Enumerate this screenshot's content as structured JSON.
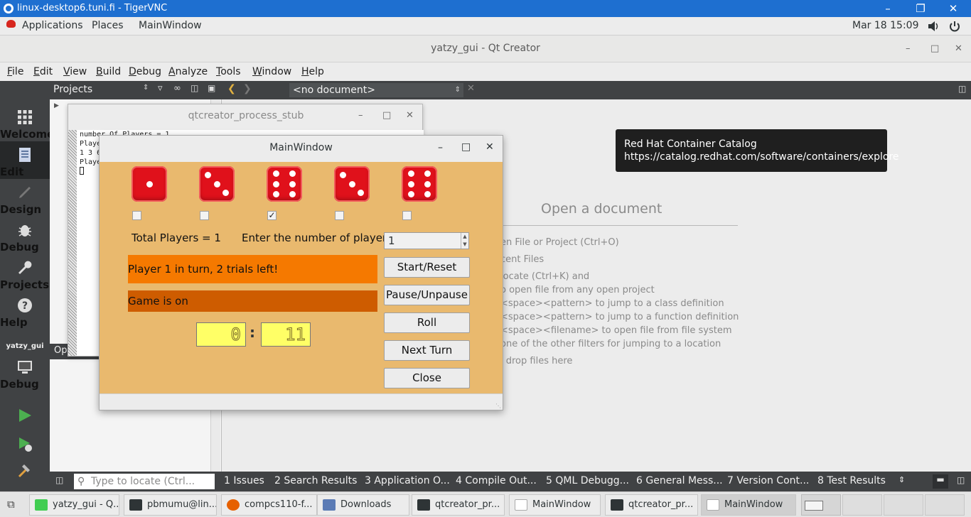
{
  "vnc": {
    "title": "linux-desktop6.tuni.fi - TigerVNC"
  },
  "gnome": {
    "applications": "Applications",
    "places": "Places",
    "active_app": "MainWindow",
    "datetime": "Mar 18  15:09"
  },
  "qt": {
    "title": "yatzy_gui - Qt Creator",
    "menu": [
      "File",
      "Edit",
      "View",
      "Build",
      "Debug",
      "Analyze",
      "Tools",
      "Window",
      "Help"
    ],
    "modes": [
      {
        "label": "Welcome",
        "icon": "grid-icon"
      },
      {
        "label": "Edit",
        "icon": "document-icon"
      },
      {
        "label": "Design",
        "icon": "pencil-icon"
      },
      {
        "label": "Debug",
        "icon": "bug-icon"
      },
      {
        "label": "Projects",
        "icon": "wrench-icon"
      },
      {
        "label": "Help",
        "icon": "help-icon"
      }
    ],
    "kit": {
      "project": "yatzy_gui",
      "label": "Debug"
    },
    "projects_label": "Projects",
    "open_docs_label": "Op",
    "doc_combo": "<no document>",
    "open_document": {
      "title": "Open a document",
      "hints": [
        "en File or Project (Ctrl+O)",
        "cent Files",
        "locate (Ctrl+K) and",
        "o open file from any open project",
        "<space><pattern> to jump to a class definition",
        "<space><pattern> to jump to a function definition",
        "<space><filename> to open file from file system",
        "one of the other filters for jumping to a location",
        "l drop files here"
      ]
    },
    "tooltip": {
      "line1": "Red Hat Container Catalog",
      "line2": "https://catalog.redhat.com/software/containers/explore"
    },
    "locator_placeholder": "Type to locate (Ctrl...",
    "output_tabs": [
      "1  Issues",
      "2  Search Results",
      "3  Application O...",
      "4  Compile Out...",
      "5  QML Debugg...",
      "6  General Mess...",
      "7  Version Cont...",
      "8  Test Results"
    ]
  },
  "stub": {
    "title": "qtcreator_process_stub",
    "lines": [
      "number Of Players = 1",
      "Playe",
      "1 3 6",
      "Playe"
    ]
  },
  "mainwindow": {
    "title": "MainWindow",
    "dice": [
      1,
      3,
      6,
      3,
      6
    ],
    "locked": [
      false,
      false,
      true,
      false,
      false
    ],
    "total_players": "Total Players = 1",
    "enter_players": "Enter the number of players:",
    "players_value": "1",
    "turn_status": "Player 1 in turn, 2 trials left!",
    "game_status": "Game is on",
    "timer_min": "0",
    "timer_sep": ":",
    "timer_sec": "11",
    "buttons": {
      "start": "Start/Reset",
      "pause": "Pause/Unpause",
      "roll": "Roll",
      "next": "Next Turn",
      "close": "Close"
    },
    "colors": {
      "turn_bar": "#f57900",
      "game_bar": "#ce5c00",
      "background": "#e9b96e",
      "die": "#e0111b"
    }
  },
  "taskbar": [
    {
      "label": "yatzy_gui - Q...",
      "icon": "qt-icon"
    },
    {
      "label": "pbmumu@lin...",
      "icon": "terminal-icon"
    },
    {
      "label": "compcs110-f...",
      "icon": "firefox-icon"
    },
    {
      "label": "Downloads",
      "icon": "folder-icon"
    },
    {
      "label": "qtcreator_pr...",
      "icon": "terminal-icon"
    },
    {
      "label": "MainWindow",
      "icon": "window-icon"
    },
    {
      "label": "qtcreator_pr...",
      "icon": "terminal-icon"
    },
    {
      "label": "MainWindow",
      "icon": "window-icon"
    }
  ]
}
